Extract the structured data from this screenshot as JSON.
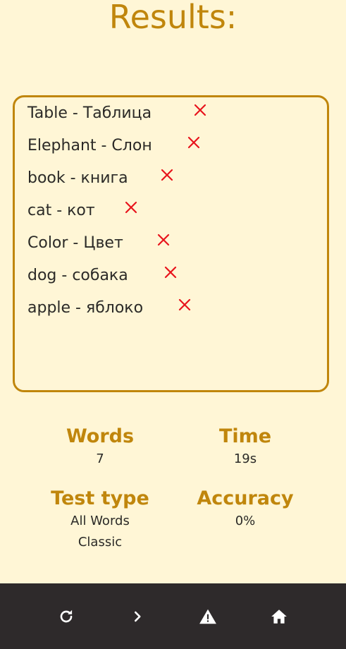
{
  "title": "Results:",
  "words": [
    {
      "text": "Table - Таблица",
      "status": "wrong",
      "icon": "cross-icon"
    },
    {
      "text": "Elephant - Слон",
      "status": "wrong",
      "icon": "cross-icon"
    },
    {
      "text": "book - книга",
      "status": "wrong",
      "icon": "cross-icon"
    },
    {
      "text": "cat - кот",
      "status": "wrong",
      "icon": "cross-icon"
    },
    {
      "text": "Color - Цвет",
      "status": "wrong",
      "icon": "cross-icon"
    },
    {
      "text": "dog - собака",
      "status": "wrong",
      "icon": "cross-icon"
    },
    {
      "text": "apple - яблоко",
      "status": "wrong",
      "icon": "cross-icon"
    }
  ],
  "stats": {
    "words": {
      "label": "Words",
      "value": "7"
    },
    "time": {
      "label": "Time",
      "value": "19s"
    },
    "test_type": {
      "label": "Test type",
      "value_line1": "All Words",
      "value_line2": "Classic"
    },
    "accuracy": {
      "label": "Accuracy",
      "value": "0%"
    }
  },
  "nav": {
    "buttons": [
      "refresh-icon",
      "chevron-right-icon",
      "warning-icon",
      "home-icon"
    ]
  },
  "colors": {
    "accent": "#c0860c",
    "background": "#fff6d6",
    "wrong": "#e8141c",
    "bar": "#2e2a2b"
  }
}
